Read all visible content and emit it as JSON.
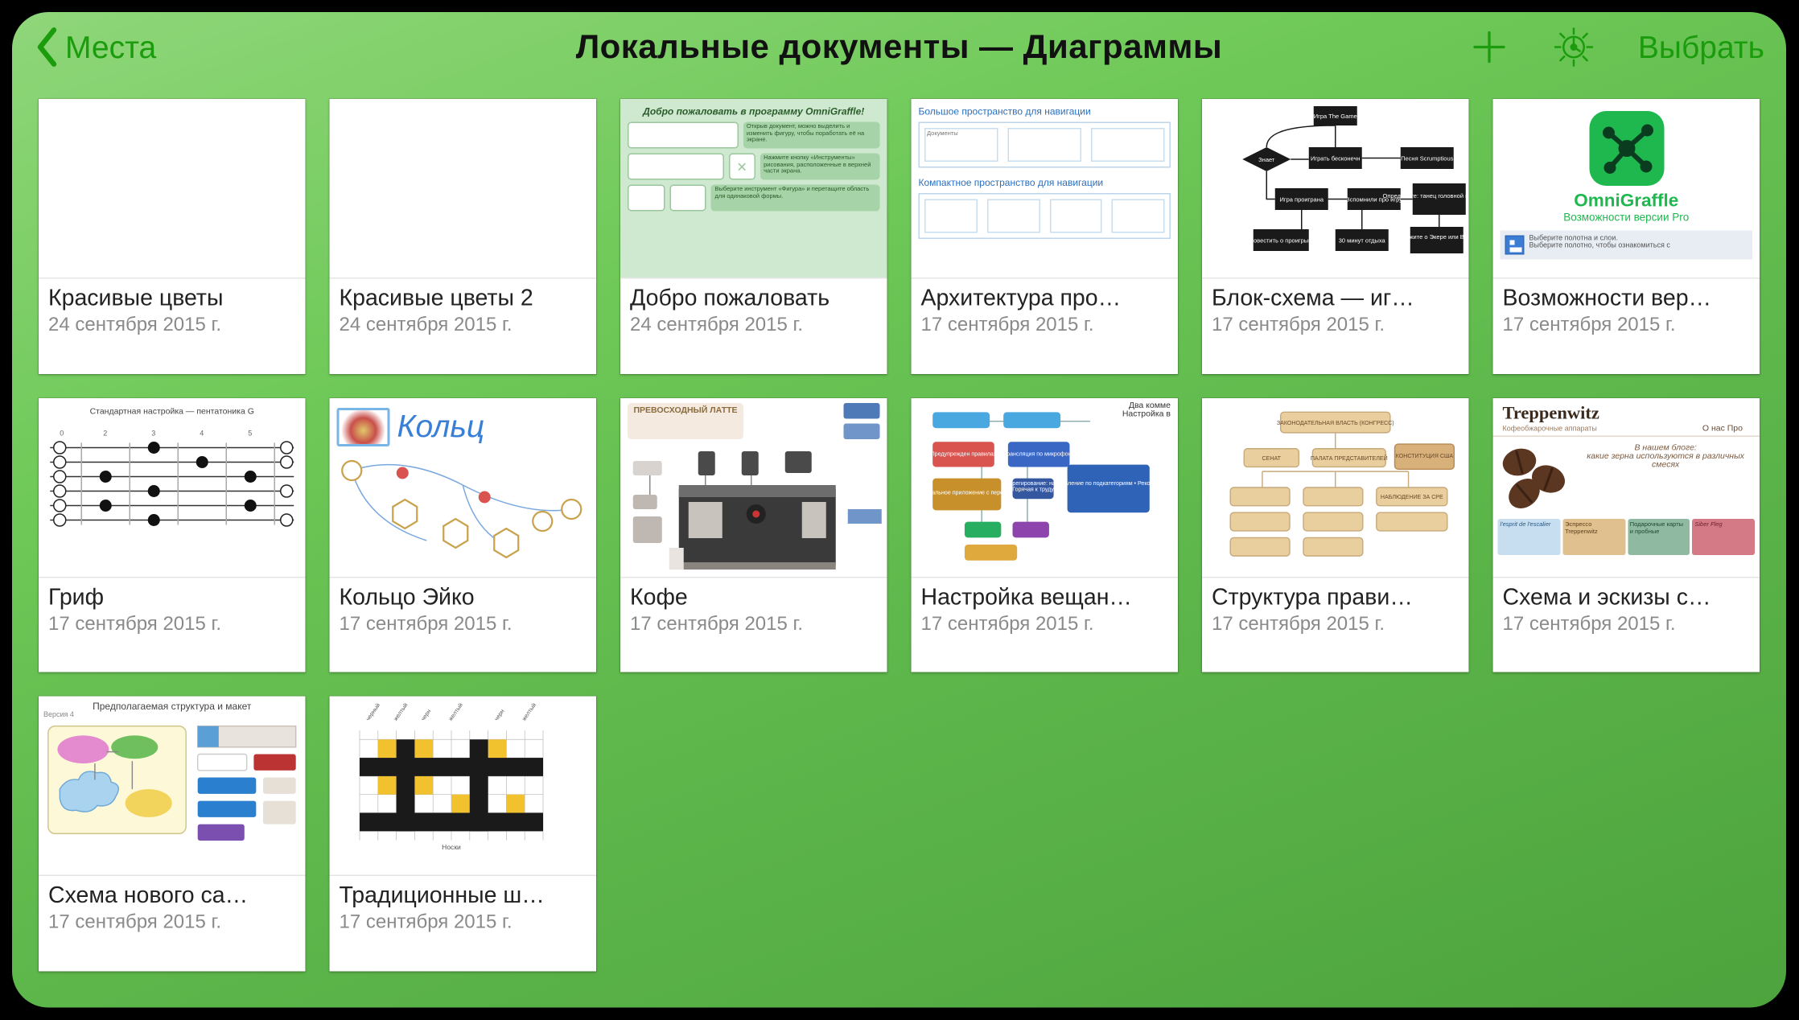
{
  "toolbar": {
    "back_label": "Места",
    "title": "Локальные документы — Диаграммы",
    "select_label": "Выбрать"
  },
  "documents": [
    {
      "name": "Красивые цветы",
      "date": "24 сентября 2015 г."
    },
    {
      "name": "Красивые цветы 2",
      "date": "24 сентября 2015 г."
    },
    {
      "name": "Добро пожаловать",
      "date": "24 сентября 2015 г."
    },
    {
      "name": "Архитектура про…",
      "date": "17 сентября 2015 г."
    },
    {
      "name": "Блок-схема — иг…",
      "date": "17 сентября 2015 г."
    },
    {
      "name": "Возможности вер…",
      "date": "17 сентября 2015 г."
    },
    {
      "name": "Гриф",
      "date": "17 сентября 2015 г."
    },
    {
      "name": "Кольцо Эйко",
      "date": "17 сентября 2015 г."
    },
    {
      "name": "Кофе",
      "date": "17 сентября 2015 г."
    },
    {
      "name": "Настройка вещан…",
      "date": "17 сентября 2015 г."
    },
    {
      "name": "Структура прави…",
      "date": "17 сентября 2015 г."
    },
    {
      "name": "Схема и эскизы с…",
      "date": "17 сентября 2015 г."
    },
    {
      "name": "Схема нового са…",
      "date": "17 сентября 2015 г."
    },
    {
      "name": "Традиционные ш…",
      "date": "17 сентября 2015 г."
    }
  ],
  "thumbs": {
    "welcome_title": "Добро пожаловать в программу OmniGraffle!",
    "arch_cap1": "Большое пространство для навигации",
    "arch_cap2": "Компактное пространство для навигации",
    "pro_title": "OmniGraffle",
    "pro_sub": "Возможности версии Pro",
    "pro_bar": "Выберите полотна и слои.\nВыберите полотно, чтобы ознакомиться с",
    "fret_label": "Стандартная настройка — пентатоника G",
    "ring_title": "Кольц",
    "latte": "ПРЕВОСХОДНЫЙ ЛАТТЕ",
    "broadcast_t1": "Два комме",
    "broadcast_t2": "Настройка в",
    "trepp_title": "Treppenwitz",
    "trepp_sub": "Кофеобжарочные аппараты",
    "trepp_nav": "О нас    Про",
    "trepp_blog": "В нашем блоге:\nкакие зерна используются в различных смесях",
    "trepp_cards": [
      "l'esprit de l'escalier",
      "Эспрессо Treppenwitz",
      "Подарочные карты и пробные",
      "Siber Fleg"
    ],
    "site_hdr": "Предполагаемая структура и макет",
    "site_ver": "Версия 4"
  }
}
